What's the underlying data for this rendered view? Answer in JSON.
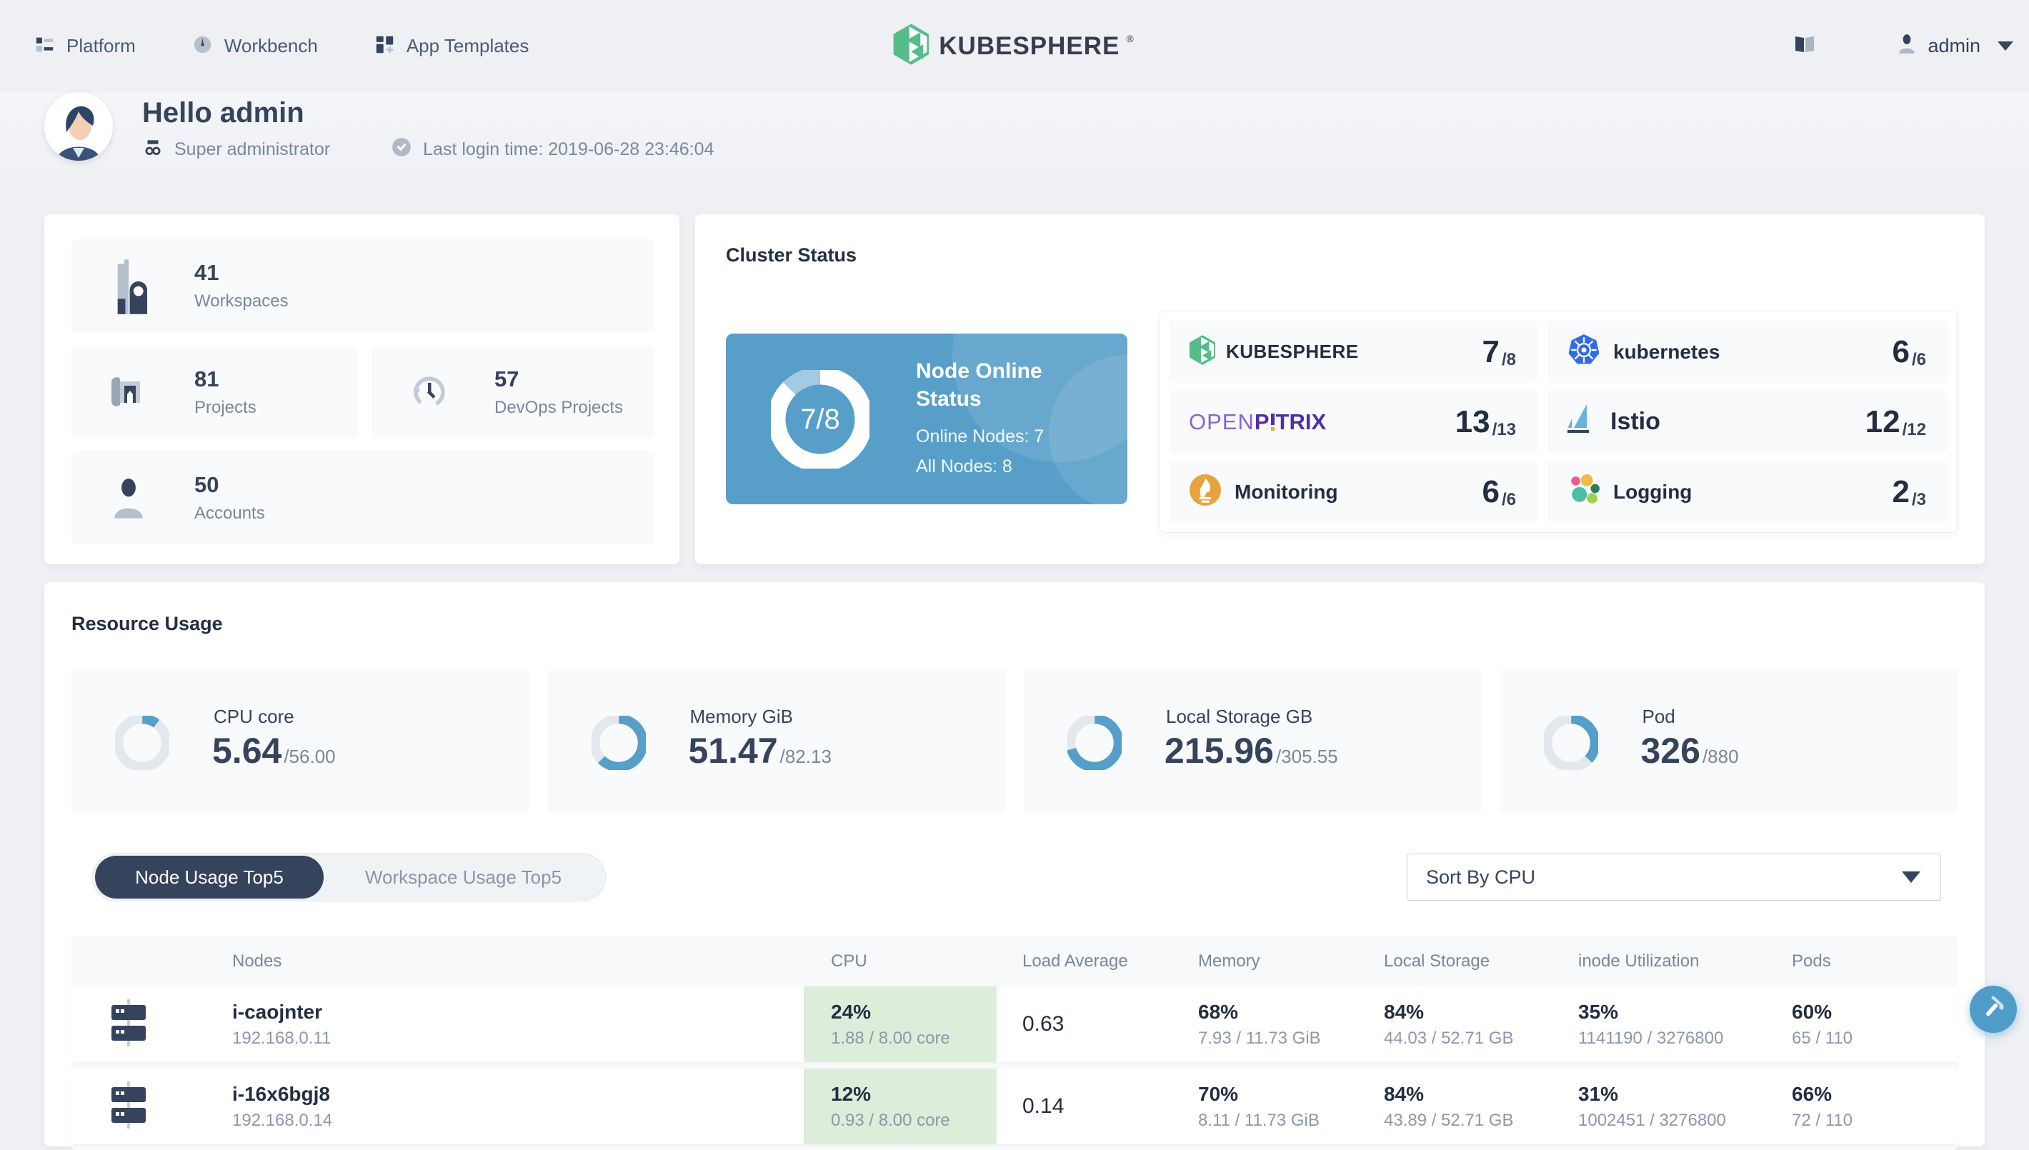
{
  "nav": {
    "platform": "Platform",
    "workbench": "Workbench",
    "app_templates": "App Templates",
    "brand": "KUBESPHERE",
    "brand_reg": "®",
    "user": {
      "name": "admin"
    }
  },
  "banner": {
    "greeting": "Hello admin",
    "role": "Super administrator",
    "last_login": "Last login time: 2019-06-28 23:46:04"
  },
  "summary": {
    "workspaces": {
      "count": "41",
      "label": "Workspaces"
    },
    "projects": {
      "count": "81",
      "label": "Projects"
    },
    "devops": {
      "count": "57",
      "label": "DevOps Projects"
    },
    "accounts": {
      "count": "50",
      "label": "Accounts"
    }
  },
  "cluster_status": {
    "title": "Cluster Status",
    "node_online": {
      "ratio": "7/8",
      "title": "Node Online Status",
      "online_label": "Online Nodes: 7",
      "all_label": "All Nodes: 8",
      "percent": 87.5
    },
    "components": [
      {
        "name": "KUBESPHERE",
        "value": "7",
        "denominator": "/8"
      },
      {
        "name": "kubernetes",
        "value": "6",
        "denominator": "/6"
      },
      {
        "name": "OpenPitrix",
        "parts": {
          "open": "OPEN",
          "p": "P",
          "trix": "TRIX"
        },
        "value": "13",
        "denominator": "/13"
      },
      {
        "name": "Istio",
        "value": "12",
        "denominator": "/12"
      },
      {
        "name": "Monitoring",
        "value": "6",
        "denominator": "/6"
      },
      {
        "name": "Logging",
        "value": "2",
        "denominator": "/3"
      }
    ]
  },
  "resource_usage": {
    "title": "Resource Usage",
    "metrics": [
      {
        "name": "CPU core",
        "used": "5.64",
        "total": "/56.00",
        "percent": 10.1
      },
      {
        "name": "Memory GiB",
        "used": "51.47",
        "total": "/82.13",
        "percent": 62.7
      },
      {
        "name": "Local Storage GB",
        "used": "215.96",
        "total": "/305.55",
        "percent": 70.7
      },
      {
        "name": "Pod",
        "used": "326",
        "total": "/880",
        "percent": 37.0
      }
    ],
    "tabs": [
      {
        "label": "Node Usage Top5"
      },
      {
        "label": "Workspace Usage Top5"
      }
    ],
    "sort": {
      "value": "Sort By CPU"
    }
  },
  "node_table": {
    "columns": [
      "Nodes",
      "CPU",
      "Load Average",
      "Memory",
      "Local Storage",
      "inode Utilization",
      "Pods"
    ],
    "rows": [
      {
        "name": "i-caojnter",
        "ip": "192.168.0.11",
        "cpu_pct": "24%",
        "cpu_detail": "1.88 / 8.00 core",
        "load": "0.63",
        "mem_pct": "68%",
        "mem_detail": "7.93 / 11.73 GiB",
        "storage_pct": "84%",
        "storage_detail": "44.03 / 52.71 GB",
        "inode_pct": "35%",
        "inode_detail": "1141190 / 3276800",
        "pods_pct": "60%",
        "pods_detail": "65 / 110"
      },
      {
        "name": "i-16x6bgj8",
        "ip": "192.168.0.14",
        "cpu_pct": "12%",
        "cpu_detail": "0.93 / 8.00 core",
        "load": "0.14",
        "mem_pct": "70%",
        "mem_detail": "8.11 / 11.73 GiB",
        "storage_pct": "84%",
        "storage_detail": "43.89 / 52.71 GB",
        "inode_pct": "31%",
        "inode_detail": "1002451 / 3276800",
        "pods_pct": "66%",
        "pods_detail": "72 / 110"
      }
    ]
  }
}
